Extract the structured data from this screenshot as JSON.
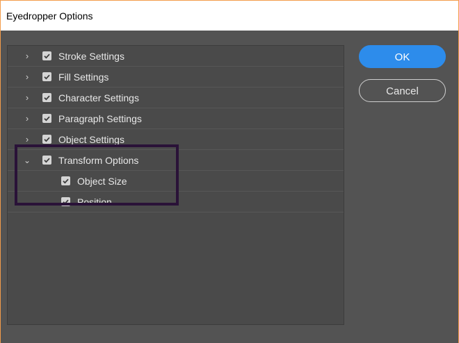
{
  "window": {
    "title": "Eyedropper Options"
  },
  "options": [
    {
      "label": "Stroke Settings",
      "checked": true,
      "expanded": false
    },
    {
      "label": "Fill Settings",
      "checked": true,
      "expanded": false
    },
    {
      "label": "Character Settings",
      "checked": true,
      "expanded": false
    },
    {
      "label": "Paragraph Settings",
      "checked": true,
      "expanded": false
    },
    {
      "label": "Object Settings",
      "checked": true,
      "expanded": false
    },
    {
      "label": "Transform Options",
      "checked": true,
      "expanded": true,
      "children": [
        {
          "label": "Object Size",
          "checked": true
        },
        {
          "label": "Position",
          "checked": true
        }
      ]
    }
  ],
  "buttons": {
    "ok": "OK",
    "cancel": "Cancel"
  },
  "colors": {
    "dialog_bg": "#535353",
    "panel_bg": "#4a4a4a",
    "ok_button": "#2d8ceb",
    "highlight_border": "#2a1238",
    "window_border": "#f39c4a"
  },
  "icons": {
    "collapsed": "chevron-right-icon",
    "expanded": "chevron-down-icon",
    "check": "checkbox-checked-icon"
  }
}
